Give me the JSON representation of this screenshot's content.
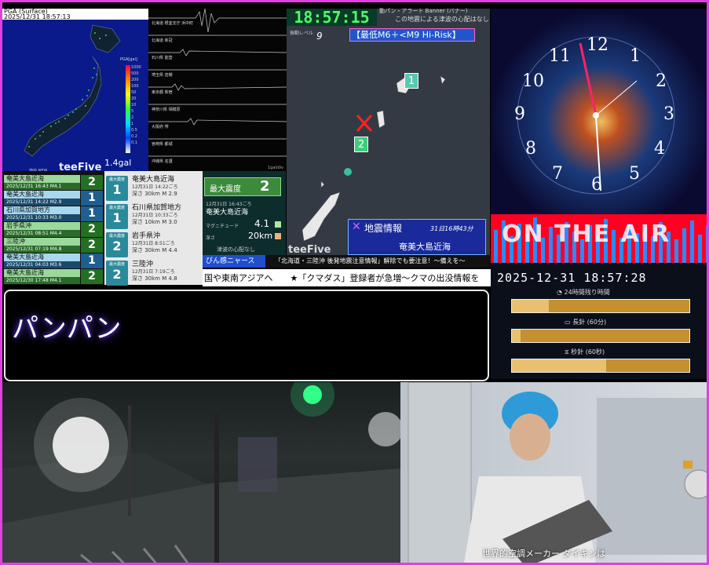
{
  "pga": {
    "header": "PGA (Surface)",
    "datetime": "2025/12/31 18:57:13",
    "unit_label": "PGA[gal]",
    "scale": [
      "1000",
      "500",
      "200",
      "100",
      "50",
      "20",
      "10",
      "5",
      "2",
      "1",
      "0.5",
      "0.2",
      "0.1"
    ],
    "current_gal": "1.4gal",
    "brand": "teeFive",
    "sub": "地中 NEW"
  },
  "waveform": {
    "stations": [
      "北海道 根室支庁 浜中町",
      "北海道 新冠",
      "石川県 能登",
      "埼玉県 岩槻",
      "東京都 新宿",
      "神奈川県 相模原",
      "大阪府 堺",
      "宮崎県 都城",
      "沖縄県 名護"
    ],
    "unit": "1gal/div"
  },
  "eq_list": [
    {
      "place": "奄美大島近海",
      "time": "2025/12/31 16:43",
      "mag": "M4.1",
      "shindo": "2",
      "cls": "g"
    },
    {
      "place": "奄美大島近海",
      "time": "2025/12/31 14:22",
      "mag": "M2.9",
      "shindo": "1",
      "cls": "b"
    },
    {
      "place": "石川県加賀地方",
      "time": "2025/12/31 10:33",
      "mag": "M3.0",
      "shindo": "1",
      "cls": "b"
    },
    {
      "place": "岩手県沖",
      "time": "2025/12/31 08:51",
      "mag": "M4.4",
      "shindo": "2",
      "cls": "g"
    },
    {
      "place": "三陸沖",
      "time": "2025/12/31 07:19",
      "mag": "M4.8",
      "shindo": "2",
      "cls": "g"
    },
    {
      "place": "奄美大島近海",
      "time": "2025/12/31 04:03",
      "mag": "M3.6",
      "shindo": "1",
      "cls": "b"
    },
    {
      "place": "奄美大島近海",
      "time": "2025/12/30 17:48",
      "mag": "M4.1",
      "shindo": "2",
      "cls": "g"
    }
  ],
  "details": [
    {
      "box_label": "最大震度",
      "shindo": "1",
      "place": "奄美大島近海",
      "time": "12月31日 14:22ごろ",
      "depth": "深さ 30km",
      "mag": "M 2.9"
    },
    {
      "box_label": "最大震度",
      "shindo": "1",
      "place": "石川県加賀地方",
      "time": "12月31日 10:33ごろ",
      "depth": "深さ 10km",
      "mag": "M 3.0"
    },
    {
      "box_label": "最大震度",
      "shindo": "2",
      "place": "岩手県沖",
      "time": "12月31日 8:51ごろ",
      "depth": "深さ 30km",
      "mag": "M 4.4"
    },
    {
      "box_label": "最大震度",
      "shindo": "2",
      "place": "三陸沖",
      "time": "12月31日 7:19ごろ",
      "depth": "深さ 30km",
      "mag": "M 4.8"
    }
  ],
  "max_card": {
    "label": "最大震度",
    "value": "2",
    "time": "12月31日 16:43ごろ",
    "place": "奄美大島近海",
    "mag_label": "マグニチュード",
    "mag": "4.1",
    "depth_label": "深さ",
    "depth": "20km",
    "tsunami": "津波の心配なし"
  },
  "quake_map": {
    "clock": "18:57:15",
    "top_banner": "この地震による津波の心配はなし",
    "top_label": "動パン・アラート Banner (バナー)",
    "level_label": "振動レベル",
    "level": "9",
    "risk": "【最低M6＋<M9 Hi-Risk】",
    "info_title": "地震情報",
    "info_time": "31日16時43分",
    "info_place": "奄美大島近海",
    "brand": "teeFive",
    "markers": [
      "1",
      "2"
    ]
  },
  "cosmos": {
    "clock_numbers": [
      "12",
      "1",
      "2",
      "3",
      "4",
      "5",
      "6",
      "7",
      "8",
      "9",
      "10",
      "11"
    ],
    "on_air": "ON THE AIR",
    "datetime": "2025-12-31 18:57:28",
    "gauges": [
      {
        "label": "24時間残り時間",
        "fraction": 0.21
      },
      {
        "label": "長針 (60分)",
        "fraction": 0.05
      },
      {
        "label": "秒針 (60秒)",
        "fraction": 0.53
      }
    ]
  },
  "ticker": {
    "alert_tag": "びん感ニャース",
    "alert_text": "「北海道・三陸沖 後発地震注意情報」解除でも要注意！〜備えを〜",
    "news": "国や東南アジアへ　　★「クマダス」登録者が急増〜クマの出没情報を"
  },
  "onomatopoeia": "パンパン",
  "cams": {
    "caption": "世界的空調メーカー ダイキンは"
  },
  "colors": {
    "frame": "#e040e0",
    "accent": "#4dff66",
    "risk": "#ff66cc"
  }
}
